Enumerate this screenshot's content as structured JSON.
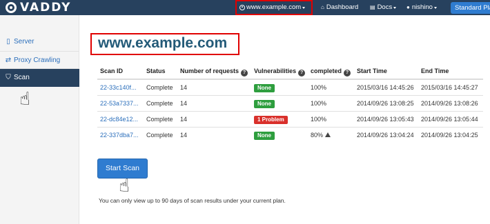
{
  "navbar": {
    "brand": "VADDY",
    "site_selector": "www.example.com",
    "dashboard": "Dashboard",
    "docs": "Docs",
    "user": "nishino",
    "plan": "Standard Plan"
  },
  "sidebar": {
    "items": [
      {
        "label": "Server",
        "icon": "server-icon"
      },
      {
        "label": "Proxy Crawling",
        "icon": "exchange-icon"
      },
      {
        "label": "Scan",
        "icon": "shield-icon",
        "active": true
      }
    ]
  },
  "main": {
    "title": "www.example.com",
    "table": {
      "headers": [
        "Scan ID",
        "Status",
        "Number of requests",
        "Vulnerabilities",
        "completed",
        "Start Time",
        "End Time"
      ],
      "rows": [
        {
          "id": "22-33c140f...",
          "status": "Complete",
          "requests": "14",
          "vuln": "None",
          "vuln_level": "ok",
          "completed": "100%",
          "start": "2015/03/16 14:45:26",
          "end": "2015/03/16 14:45:27"
        },
        {
          "id": "22-53a7337...",
          "status": "Complete",
          "requests": "14",
          "vuln": "None",
          "vuln_level": "ok",
          "completed": "100%",
          "start": "2014/09/26 13:08:25",
          "end": "2014/09/26 13:08:26"
        },
        {
          "id": "22-dc84e12...",
          "status": "Complete",
          "requests": "14",
          "vuln": "1 Problem",
          "vuln_level": "bad",
          "completed": "100%",
          "start": "2014/09/26 13:05:43",
          "end": "2014/09/26 13:05:44"
        },
        {
          "id": "22-337dba7...",
          "status": "Complete",
          "requests": "14",
          "vuln": "None",
          "vuln_level": "ok",
          "completed": "80%",
          "start": "2014/09/26 13:04:24",
          "end": "2014/09/26 13:04:25"
        }
      ]
    },
    "start_button": "Start Scan",
    "footnote": "You can only view up to 90 days of scan results under your current plan."
  },
  "colors": {
    "navbar": "#27415e",
    "accent": "#2f7cd0",
    "success": "#2e9e3e",
    "danger": "#d9302b",
    "highlight": "#e00000"
  }
}
